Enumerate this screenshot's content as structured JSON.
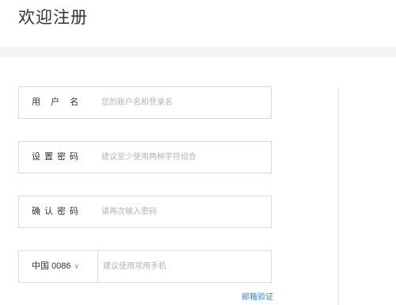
{
  "header": {
    "title": "欢迎注册"
  },
  "form": {
    "username": {
      "label": "用 户 名",
      "placeholder": "您的账户名和登录名"
    },
    "password": {
      "label": "设置密码",
      "placeholder": "建议至少使用两种字符组合"
    },
    "confirm_password": {
      "label": "确认密码",
      "placeholder": "请再次输入密码"
    },
    "phone": {
      "country_code": "中国 0086",
      "placeholder": "建议使用常用手机"
    },
    "email_link": "邮箱验证"
  }
}
